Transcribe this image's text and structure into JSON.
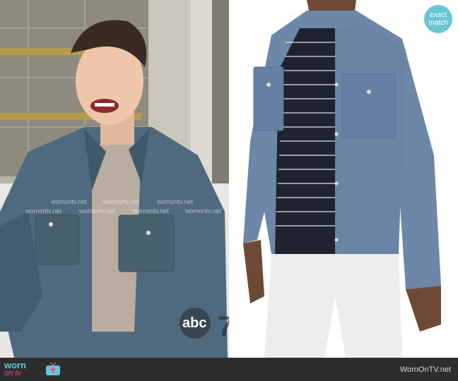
{
  "left_photo": {
    "watermark": "wornontv.net",
    "network_bug": "abc",
    "network_number": "7"
  },
  "badge": {
    "line1": "exact",
    "line2": "match",
    "color": "#69c7d5"
  },
  "footer": {
    "logo_top": "worn",
    "logo_bottom": "on tv",
    "site": "WornOnTV.net",
    "accent_cyan": "#5ec9d8",
    "accent_pink": "#ee4d97"
  }
}
